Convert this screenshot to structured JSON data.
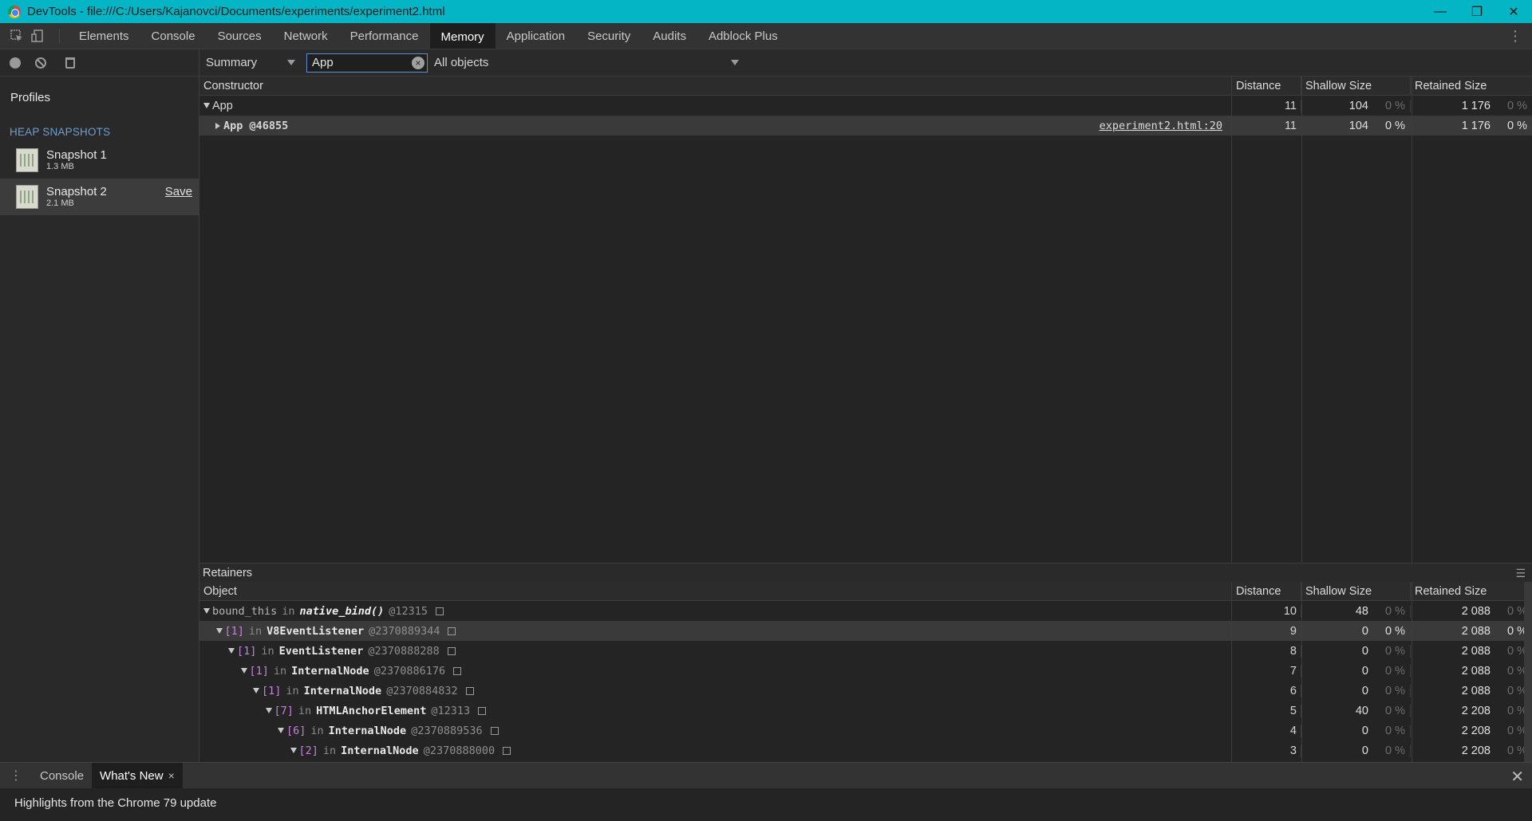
{
  "window": {
    "title": "DevTools - file:///C:/Users/Kajanovci/Documents/experiments/experiment2.html",
    "minimize": "—",
    "restore": "❐",
    "close": "✕"
  },
  "toolbar": {
    "tabs": [
      "Elements",
      "Console",
      "Sources",
      "Network",
      "Performance",
      "Memory",
      "Application",
      "Security",
      "Audits",
      "Adblock Plus"
    ],
    "active_tab": "Memory",
    "more": "⋮"
  },
  "sidebar": {
    "profiles_label": "Profiles",
    "section_title": "HEAP SNAPSHOTS",
    "snapshots": [
      {
        "name": "Snapshot 1",
        "size": "1.3 MB"
      },
      {
        "name": "Snapshot 2",
        "size": "2.1 MB",
        "save": "Save"
      }
    ]
  },
  "filters": {
    "view": "Summary",
    "class_filter_value": "App",
    "objects": "All objects"
  },
  "summary_table": {
    "headers": {
      "constructor": "Constructor",
      "distance": "Distance",
      "shallow": "Shallow Size",
      "retained": "Retained Size"
    },
    "rows": [
      {
        "name": "App",
        "distance": "11",
        "shallow": "104",
        "shallow_pct": "0 %",
        "retained": "1 176",
        "retained_pct": "0 %"
      },
      {
        "name": "App @46855",
        "link": "experiment2.html:20",
        "distance": "11",
        "shallow": "104",
        "shallow_pct": "0 %",
        "retained": "1 176",
        "retained_pct": "0 %"
      }
    ]
  },
  "retainers": {
    "title": "Retainers",
    "headers": {
      "object": "Object",
      "distance": "Distance",
      "shallow": "Shallow Size",
      "retained": "Retained Size"
    },
    "rows": [
      {
        "key": "bound_this",
        "in": "in",
        "cls": "native_bind()",
        "id": "@12315",
        "distance": "10",
        "shallow": "48",
        "shallow_pct": "0 %",
        "retained": "2 088",
        "retained_pct": "0 %"
      },
      {
        "key": "[1]",
        "in": "in",
        "cls": "V8EventListener",
        "id": "@2370889344",
        "distance": "9",
        "shallow": "0",
        "shallow_pct": "0 %",
        "retained": "2 088",
        "retained_pct": "0 %"
      },
      {
        "key": "[1]",
        "in": "in",
        "cls": "EventListener",
        "id": "@2370888288",
        "distance": "8",
        "shallow": "0",
        "shallow_pct": "0 %",
        "retained": "2 088",
        "retained_pct": "0 %"
      },
      {
        "key": "[1]",
        "in": "in",
        "cls": "InternalNode",
        "id": "@2370886176",
        "distance": "7",
        "shallow": "0",
        "shallow_pct": "0 %",
        "retained": "2 088",
        "retained_pct": "0 %"
      },
      {
        "key": "[1]",
        "in": "in",
        "cls": "InternalNode",
        "id": "@2370884832",
        "distance": "6",
        "shallow": "0",
        "shallow_pct": "0 %",
        "retained": "2 088",
        "retained_pct": "0 %"
      },
      {
        "key": "[7]",
        "in": "in",
        "cls": "HTMLAnchorElement",
        "id": "@12313",
        "distance": "5",
        "shallow": "40",
        "shallow_pct": "0 %",
        "retained": "2 208",
        "retained_pct": "0 %"
      },
      {
        "key": "[6]",
        "in": "in",
        "cls": "InternalNode",
        "id": "@2370889536",
        "distance": "4",
        "shallow": "0",
        "shallow_pct": "0 %",
        "retained": "2 208",
        "retained_pct": "0 %"
      },
      {
        "key": "[2]",
        "in": "in",
        "cls": "InternalNode",
        "id": "@2370888000",
        "distance": "3",
        "shallow": "0",
        "shallow_pct": "0 %",
        "retained": "2 208",
        "retained_pct": "0 %"
      }
    ]
  },
  "drawer": {
    "tabs": [
      "Console",
      "What's New"
    ],
    "active_tab": "What's New",
    "close_tab": "×",
    "close_drawer": "✕",
    "message": "Highlights from the Chrome 79 update"
  }
}
